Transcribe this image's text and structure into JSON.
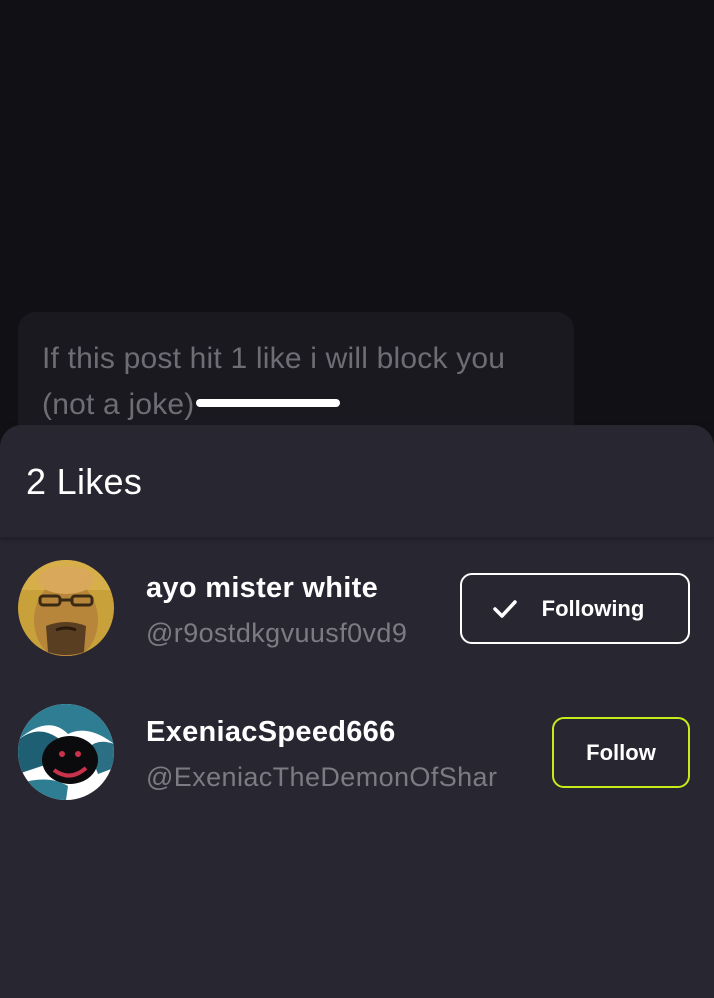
{
  "post": {
    "text": "If this post hit 1 like i will block you (not a joke)"
  },
  "likes_sheet": {
    "title": "2 Likes",
    "users": [
      {
        "name": "ayo mister white",
        "handle": "@r9ostdkgvuusf0vd9",
        "button_label": "Following",
        "button_state": "following"
      },
      {
        "name": "ExeniacSpeed666",
        "handle": "@ExeniacTheDemonOfShar",
        "button_label": "Follow",
        "button_state": "not-following"
      }
    ]
  },
  "colors": {
    "background": "#111015",
    "sheet": "#282631",
    "follow_accent": "#c6ec1c",
    "muted_text": "#7c7b83"
  }
}
